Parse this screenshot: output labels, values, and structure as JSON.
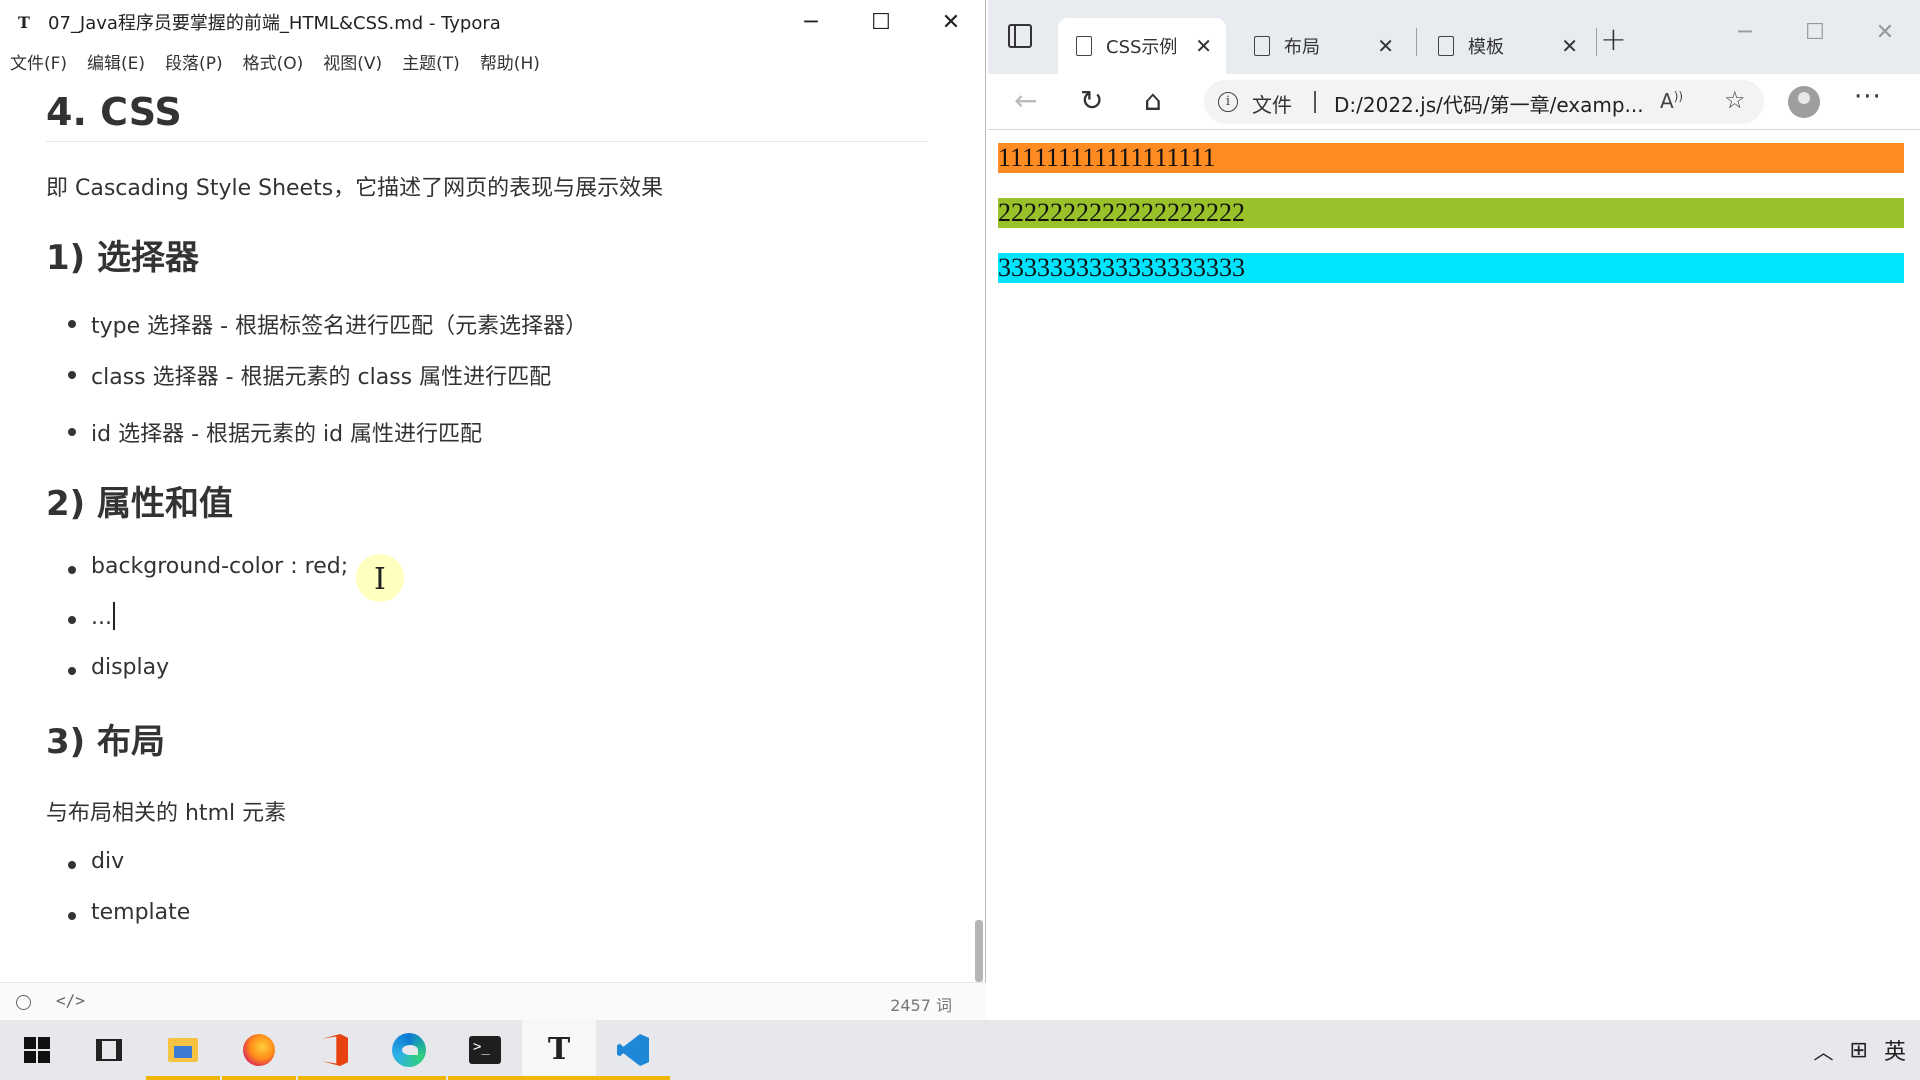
{
  "typora": {
    "title": "07_Java程序员要掌握的前端_HTML&CSS.md - Typora",
    "app_icon": "T",
    "menus": [
      "文件(F)",
      "编辑(E)",
      "段落(P)",
      "格式(O)",
      "视图(V)",
      "主题(T)",
      "帮助(H)"
    ],
    "doc": {
      "h1": "4. CSS",
      "intro": "即 Cascading  Style  Sheets，它描述了网页的表现与展示效果",
      "sections": [
        {
          "heading": "1) 选择器",
          "items": [
            "type 选择器 - 根据标签名进行匹配（元素选择器）",
            "class 选择器 - 根据元素的 class 属性进行匹配",
            "id 选择器  - 根据元素的 id 属性进行匹配"
          ]
        },
        {
          "heading": "2) 属性和值",
          "items": [
            "background-color : red;",
            "...",
            "display"
          ]
        },
        {
          "heading": "3) 布局",
          "paragraph": "与布局相关的 html 元素",
          "items": [
            "div",
            "template"
          ]
        }
      ]
    },
    "status": {
      "word_count": "2457 词",
      "source_toggle": "</>"
    }
  },
  "browser": {
    "tabs": [
      {
        "label": "CSS示例",
        "active": true
      },
      {
        "label": "布局",
        "active": false
      },
      {
        "label": "模板",
        "active": false
      }
    ],
    "address": {
      "scheme_label": "文件",
      "url": "D:/2022.js/代码/第一章/examp..."
    },
    "page": {
      "blocks": [
        {
          "text": "111111111111111111",
          "color": "#fe8c22"
        },
        {
          "text": "2222222222222222222",
          "color": "#98c12a"
        },
        {
          "text": "3333333333333333333",
          "color": "#00e5ff"
        }
      ]
    }
  },
  "taskbar": {
    "apps": [
      {
        "icon": "windows-start-icon",
        "state": "none"
      },
      {
        "icon": "task-view-icon",
        "state": "none"
      },
      {
        "icon": "file-explorer-icon",
        "state": "open"
      },
      {
        "icon": "firefox-icon",
        "state": "open"
      },
      {
        "icon": "office-icon",
        "state": "open"
      },
      {
        "icon": "edge-icon",
        "state": "open"
      },
      {
        "icon": "terminal-icon",
        "state": "open"
      },
      {
        "icon": "typora-icon",
        "state": "active"
      },
      {
        "icon": "vscode-icon",
        "state": "open"
      }
    ],
    "tray": {
      "ime_mode": "英"
    }
  }
}
